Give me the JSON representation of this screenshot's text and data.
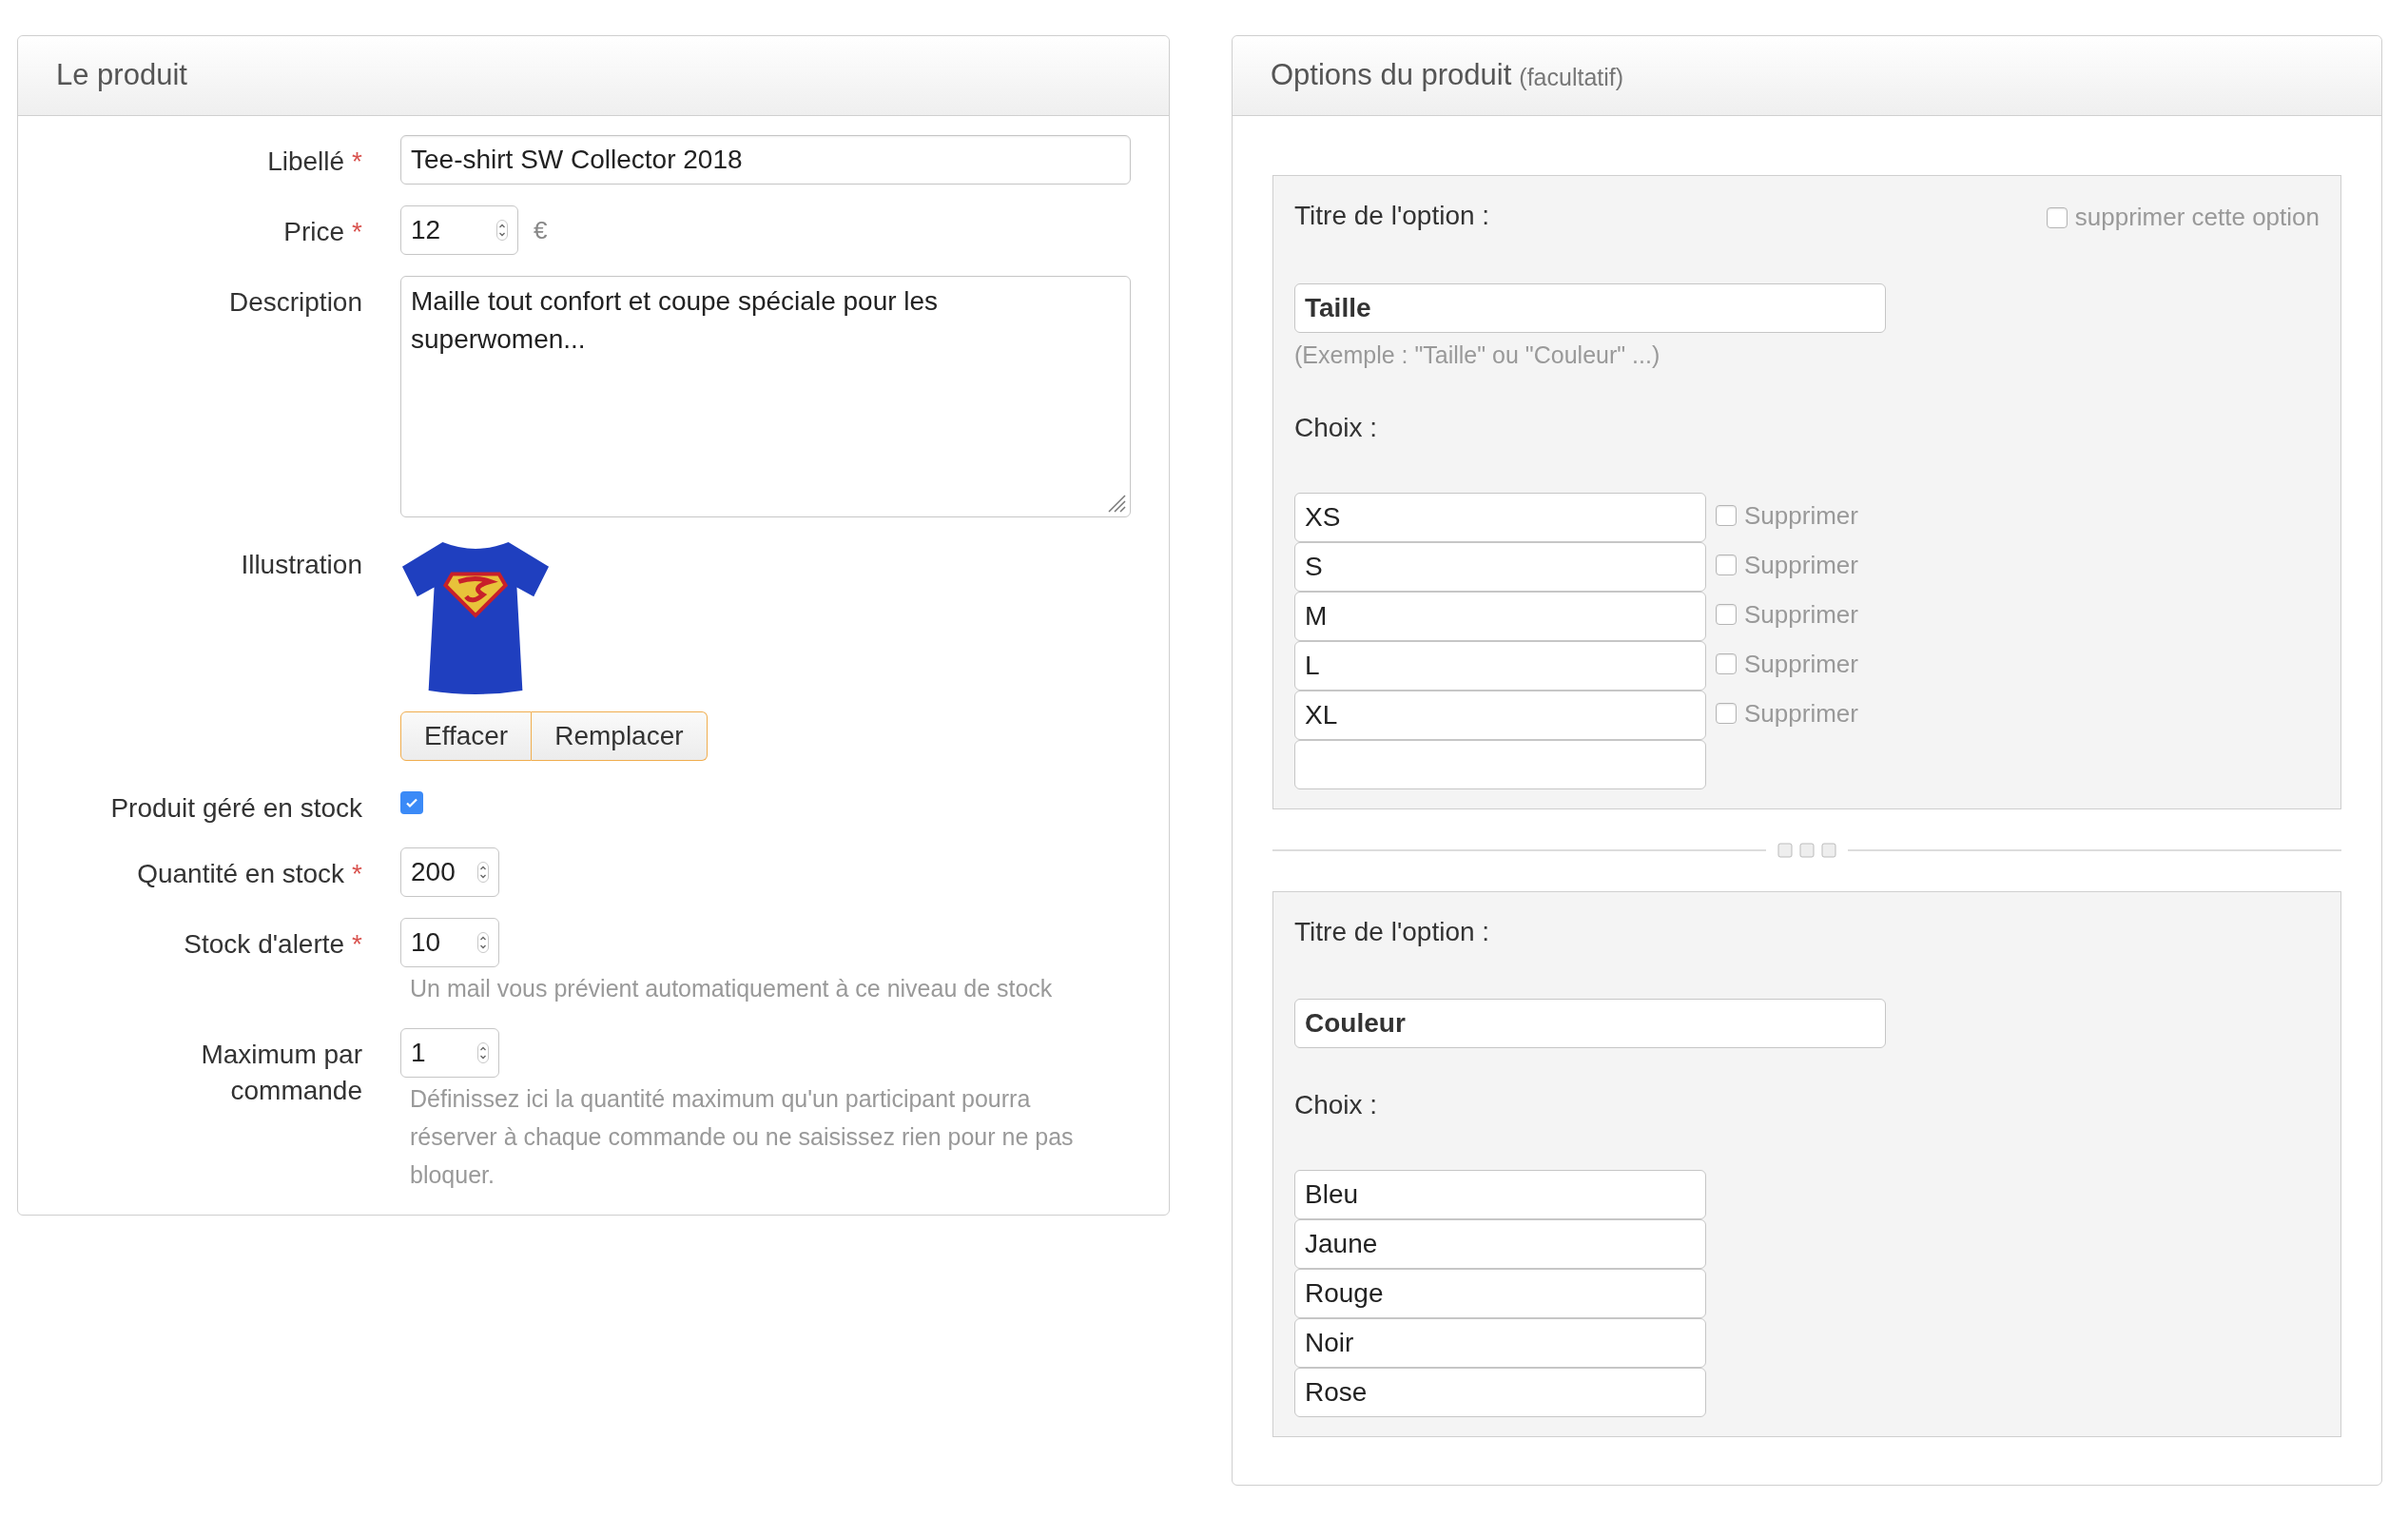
{
  "product_panel": {
    "title": "Le produit",
    "fields": [
      {
        "kind": "text",
        "label": "Libellé",
        "required_mark": "*",
        "value": "Tee-shirt SW Collector 2018"
      },
      {
        "kind": "number",
        "label": "Price",
        "required_mark": "*",
        "value": "12",
        "unit": "€"
      },
      {
        "kind": "textarea",
        "label": "Description",
        "value": "Maille tout confort et coupe spéciale pour les superwomen..."
      },
      {
        "kind": "image",
        "label": "Illustration",
        "buttons": [
          "Effacer",
          "Remplacer"
        ]
      },
      {
        "kind": "checkbox",
        "label": "Produit géré en stock",
        "checked": true
      },
      {
        "kind": "number",
        "label": "Quantité en stock",
        "required_mark": "*",
        "value": "200"
      },
      {
        "kind": "number",
        "label": "Stock d'alerte",
        "required_mark": "*",
        "value": "10",
        "help": "Un mail vous prévient automatiquement à ce niveau de stock"
      },
      {
        "kind": "number",
        "label": "Maximum par commande",
        "value": "1",
        "help": "Définissez ici la quantité maximum qu'un participant pourra réserver à chaque commande ou ne saisissez rien pour ne pas bloquer."
      }
    ]
  },
  "options_panel": {
    "title": "Options du produit",
    "subtitle": "(facultatif)",
    "options": [
      {
        "title_label": "Titre de l'option :",
        "delete_label": "supprimer cette option",
        "delete_checked": false,
        "value": "Taille",
        "hint": "(Exemple : \"Taille\" ou \"Couleur\" ...)",
        "choices_label": "Choix :",
        "choices": [
          {
            "kind": "entry",
            "value": "XS",
            "delete_label": "Supprimer",
            "delete_checked": false
          },
          {
            "kind": "entry",
            "value": "S",
            "delete_label": "Supprimer",
            "delete_checked": false
          },
          {
            "kind": "entry",
            "value": "M",
            "delete_label": "Supprimer",
            "delete_checked": false
          },
          {
            "kind": "entry",
            "value": "L",
            "delete_label": "Supprimer",
            "delete_checked": false
          },
          {
            "kind": "entry",
            "value": "XL",
            "delete_label": "Supprimer",
            "delete_checked": false
          },
          {
            "kind": "blank"
          }
        ]
      },
      {
        "title_label": "Titre de l'option :",
        "value": "Couleur",
        "choices_label": "Choix :",
        "choices": [
          {
            "kind": "entry",
            "value": "Bleu"
          },
          {
            "kind": "entry",
            "value": "Jaune"
          },
          {
            "kind": "entry",
            "value": "Rouge"
          },
          {
            "kind": "entry",
            "value": "Noir"
          },
          {
            "kind": "entry",
            "value": "Rose"
          }
        ]
      }
    ]
  }
}
